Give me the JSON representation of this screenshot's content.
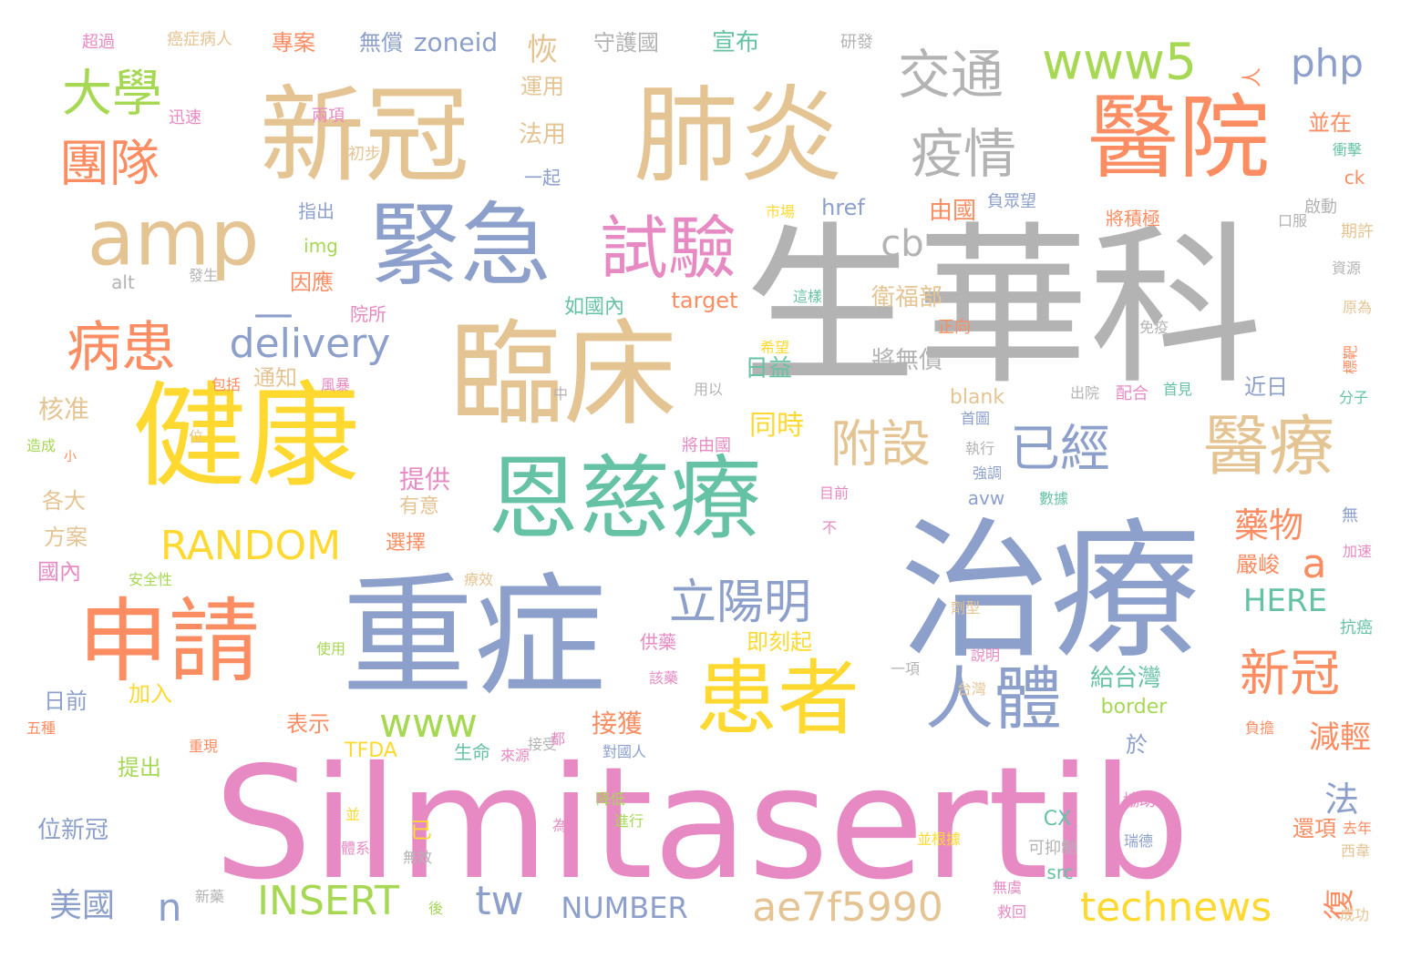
{
  "wordcloud": {
    "background": "#ffffff",
    "palette": {
      "gray": "#b3b3b3",
      "tan": "#e5c494",
      "orange": "#fc8d62",
      "blue": "#8da0cb",
      "green": "#66c2a5",
      "yellow": "#ffd92f",
      "lime": "#a6d854",
      "pink": "#e78ac3"
    },
    "words": [
      {
        "text": "Silmitasertib",
        "color": "pink"
      },
      {
        "text": "生華科",
        "color": "gray"
      },
      {
        "text": "治療",
        "color": "blue"
      },
      {
        "text": "重症",
        "color": "blue"
      },
      {
        "text": "新冠",
        "color": "tan"
      },
      {
        "text": "肺炎",
        "color": "tan"
      },
      {
        "text": "臨床",
        "color": "tan"
      },
      {
        "text": "健康",
        "color": "yellow"
      },
      {
        "text": "恩慈療",
        "color": "green"
      },
      {
        "text": "醫院",
        "color": "orange"
      },
      {
        "text": "申請",
        "color": "orange"
      },
      {
        "text": "緊急",
        "color": "blue"
      },
      {
        "text": "患者",
        "color": "yellow"
      },
      {
        "text": "amp",
        "color": "tan"
      },
      {
        "text": "試驗",
        "color": "pink"
      },
      {
        "text": "醫療",
        "color": "tan"
      },
      {
        "text": "人體",
        "color": "blue"
      },
      {
        "text": "交通",
        "color": "gray"
      },
      {
        "text": "疫情",
        "color": "gray"
      },
      {
        "text": "www5",
        "color": "lime"
      },
      {
        "text": "病患",
        "color": "orange"
      },
      {
        "text": "大學",
        "color": "lime"
      },
      {
        "text": "團隊",
        "color": "orange"
      },
      {
        "text": "已經",
        "color": "blue"
      },
      {
        "text": "附設",
        "color": "tan"
      },
      {
        "text": "立陽明",
        "color": "blue"
      },
      {
        "text": "新冠",
        "color": "orange"
      },
      {
        "text": "php",
        "color": "blue"
      },
      {
        "text": "delivery",
        "color": "blue"
      },
      {
        "text": "RANDOM",
        "color": "yellow"
      },
      {
        "text": "technews",
        "color": "yellow"
      },
      {
        "text": "ae7f5990",
        "color": "tan"
      },
      {
        "text": "INSERT",
        "color": "lime"
      },
      {
        "text": "www",
        "color": "lime"
      },
      {
        "text": "tw",
        "color": "blue"
      },
      {
        "text": "NUMBER",
        "color": "blue"
      },
      {
        "text": "cb",
        "color": "gray"
      },
      {
        "text": "a",
        "color": "orange"
      },
      {
        "text": "n",
        "color": "blue"
      },
      {
        "text": "—",
        "color": "blue"
      },
      {
        "text": "美國",
        "color": "blue"
      },
      {
        "text": "藥物",
        "color": "orange"
      },
      {
        "text": "HERE",
        "color": "green"
      },
      {
        "text": "減輕",
        "color": "orange"
      },
      {
        "text": "恢",
        "color": "tan"
      },
      {
        "text": "復",
        "color": "orange"
      },
      {
        "text": "法",
        "color": "blue"
      },
      {
        "text": "接獲",
        "color": "orange"
      },
      {
        "text": "給台灣",
        "color": "green"
      },
      {
        "text": "同時",
        "color": "yellow"
      },
      {
        "text": "提供",
        "color": "pink"
      },
      {
        "text": "衛福部",
        "color": "tan"
      },
      {
        "text": "將無償",
        "color": "gray"
      },
      {
        "text": "zoneid",
        "color": "blue"
      },
      {
        "text": "無償",
        "color": "blue"
      },
      {
        "text": "專案",
        "color": "orange"
      },
      {
        "text": "宣布",
        "color": "green"
      },
      {
        "text": "守護國",
        "color": "gray"
      },
      {
        "text": "超過",
        "color": "pink"
      },
      {
        "text": "癌症病人",
        "color": "tan"
      },
      {
        "text": "研發",
        "color": "gray"
      },
      {
        "text": "運用",
        "color": "tan"
      },
      {
        "text": "法用",
        "color": "tan"
      },
      {
        "text": "一起",
        "color": "blue"
      },
      {
        "text": "並在",
        "color": "orange"
      },
      {
        "text": "ck",
        "color": "orange"
      },
      {
        "text": "href",
        "color": "blue"
      },
      {
        "text": "由國",
        "color": "orange"
      },
      {
        "text": "指出",
        "color": "blue"
      },
      {
        "text": "img",
        "color": "lime"
      },
      {
        "text": "因應",
        "color": "orange"
      },
      {
        "text": "alt",
        "color": "gray"
      },
      {
        "text": "target",
        "color": "orange"
      },
      {
        "text": "如國內",
        "color": "green"
      },
      {
        "text": "院所",
        "color": "pink"
      },
      {
        "text": "日益",
        "color": "green"
      },
      {
        "text": "通知",
        "color": "tan"
      },
      {
        "text": "blank",
        "color": "tan"
      },
      {
        "text": "近日",
        "color": "blue"
      },
      {
        "text": "核准",
        "color": "tan"
      },
      {
        "text": "各大",
        "color": "tan"
      },
      {
        "text": "方案",
        "color": "tan"
      },
      {
        "text": "國內",
        "color": "pink"
      },
      {
        "text": "選擇",
        "color": "orange"
      },
      {
        "text": "有意",
        "color": "tan"
      },
      {
        "text": "avw",
        "color": "blue"
      },
      {
        "text": "日前",
        "color": "blue"
      },
      {
        "text": "加入",
        "color": "yellow"
      },
      {
        "text": "表示",
        "color": "orange"
      },
      {
        "text": "border",
        "color": "lime"
      },
      {
        "text": "提出",
        "color": "lime"
      },
      {
        "text": "TFDA",
        "color": "yellow"
      },
      {
        "text": "生命",
        "color": "green"
      },
      {
        "text": "位新冠",
        "color": "blue"
      },
      {
        "text": "已",
        "color": "yellow"
      },
      {
        "text": "CX",
        "color": "green"
      },
      {
        "text": "src",
        "color": "green"
      },
      {
        "text": "嚴峻",
        "color": "orange"
      },
      {
        "text": "即刻起",
        "color": "yellow"
      },
      {
        "text": "供藥",
        "color": "pink"
      },
      {
        "text": "於",
        "color": "blue"
      },
      {
        "text": "還項",
        "color": "orange"
      },
      {
        "text": "人",
        "color": "orange"
      },
      {
        "text": "迅速",
        "color": "pink"
      },
      {
        "text": "兩項",
        "color": "pink"
      },
      {
        "text": "初步",
        "color": "tan"
      },
      {
        "text": "衝擊",
        "color": "green"
      },
      {
        "text": "啟動",
        "color": "gray"
      },
      {
        "text": "期許",
        "color": "tan"
      },
      {
        "text": "口服",
        "color": "gray"
      },
      {
        "text": "資源",
        "color": "gray"
      },
      {
        "text": "原為",
        "color": "tan"
      },
      {
        "text": "標靶",
        "color": "orange"
      },
      {
        "text": "分子",
        "color": "green"
      },
      {
        "text": "負眾望",
        "color": "blue"
      },
      {
        "text": "將積極",
        "color": "orange"
      },
      {
        "text": "市場",
        "color": "yellow"
      },
      {
        "text": "發生",
        "color": "gray"
      },
      {
        "text": "這樣",
        "color": "green"
      },
      {
        "text": "正向",
        "color": "orange"
      },
      {
        "text": "免疫",
        "color": "gray"
      },
      {
        "text": "希望",
        "color": "yellow"
      },
      {
        "text": "包括",
        "color": "orange"
      },
      {
        "text": "風暴",
        "color": "pink"
      },
      {
        "text": "用以",
        "color": "gray"
      },
      {
        "text": "出院",
        "color": "gray"
      },
      {
        "text": "配合",
        "color": "pink"
      },
      {
        "text": "首見",
        "color": "green"
      },
      {
        "text": "中",
        "color": "gray"
      },
      {
        "text": "首圖",
        "color": "blue"
      },
      {
        "text": "將由國",
        "color": "pink"
      },
      {
        "text": "執行",
        "color": "gray"
      },
      {
        "text": "強調",
        "color": "blue"
      },
      {
        "text": "數據",
        "color": "green"
      },
      {
        "text": "目前",
        "color": "pink"
      },
      {
        "text": "不",
        "color": "pink"
      },
      {
        "text": "無",
        "color": "blue"
      },
      {
        "text": "加速",
        "color": "pink"
      },
      {
        "text": "造成",
        "color": "lime"
      },
      {
        "text": "小",
        "color": "orange"
      },
      {
        "text": "位",
        "color": "tan"
      },
      {
        "text": "安全性",
        "color": "lime"
      },
      {
        "text": "療效",
        "color": "tan"
      },
      {
        "text": "劑型",
        "color": "tan"
      },
      {
        "text": "抗癌",
        "color": "green"
      },
      {
        "text": "使用",
        "color": "lime"
      },
      {
        "text": "說明",
        "color": "pink"
      },
      {
        "text": "一項",
        "color": "gray"
      },
      {
        "text": "台灣",
        "color": "tan"
      },
      {
        "text": "該藥",
        "color": "pink"
      },
      {
        "text": "五種",
        "color": "orange"
      },
      {
        "text": "重現",
        "color": "orange"
      },
      {
        "text": "接受",
        "color": "gray"
      },
      {
        "text": "都",
        "color": "pink"
      },
      {
        "text": "來源",
        "color": "pink"
      },
      {
        "text": "對國人",
        "color": "blue"
      },
      {
        "text": "負擔",
        "color": "orange"
      },
      {
        "text": "並",
        "color": "yellow"
      },
      {
        "text": "降低",
        "color": "lime"
      },
      {
        "text": "進行",
        "color": "lime"
      },
      {
        "text": "為",
        "color": "pink"
      },
      {
        "text": "協助",
        "color": "pink"
      },
      {
        "text": "並根據",
        "color": "yellow"
      },
      {
        "text": "瑞德",
        "color": "blue"
      },
      {
        "text": "去年",
        "color": "orange"
      },
      {
        "text": "西韋",
        "color": "tan"
      },
      {
        "text": "體系",
        "color": "pink"
      },
      {
        "text": "無效",
        "color": "gray"
      },
      {
        "text": "可抑制",
        "color": "gray"
      },
      {
        "text": "無虞",
        "color": "pink"
      },
      {
        "text": "救回",
        "color": "pink"
      },
      {
        "text": "成功",
        "color": "tan"
      },
      {
        "text": "新藥",
        "color": "gray"
      },
      {
        "text": "後",
        "color": "lime"
      }
    ]
  }
}
